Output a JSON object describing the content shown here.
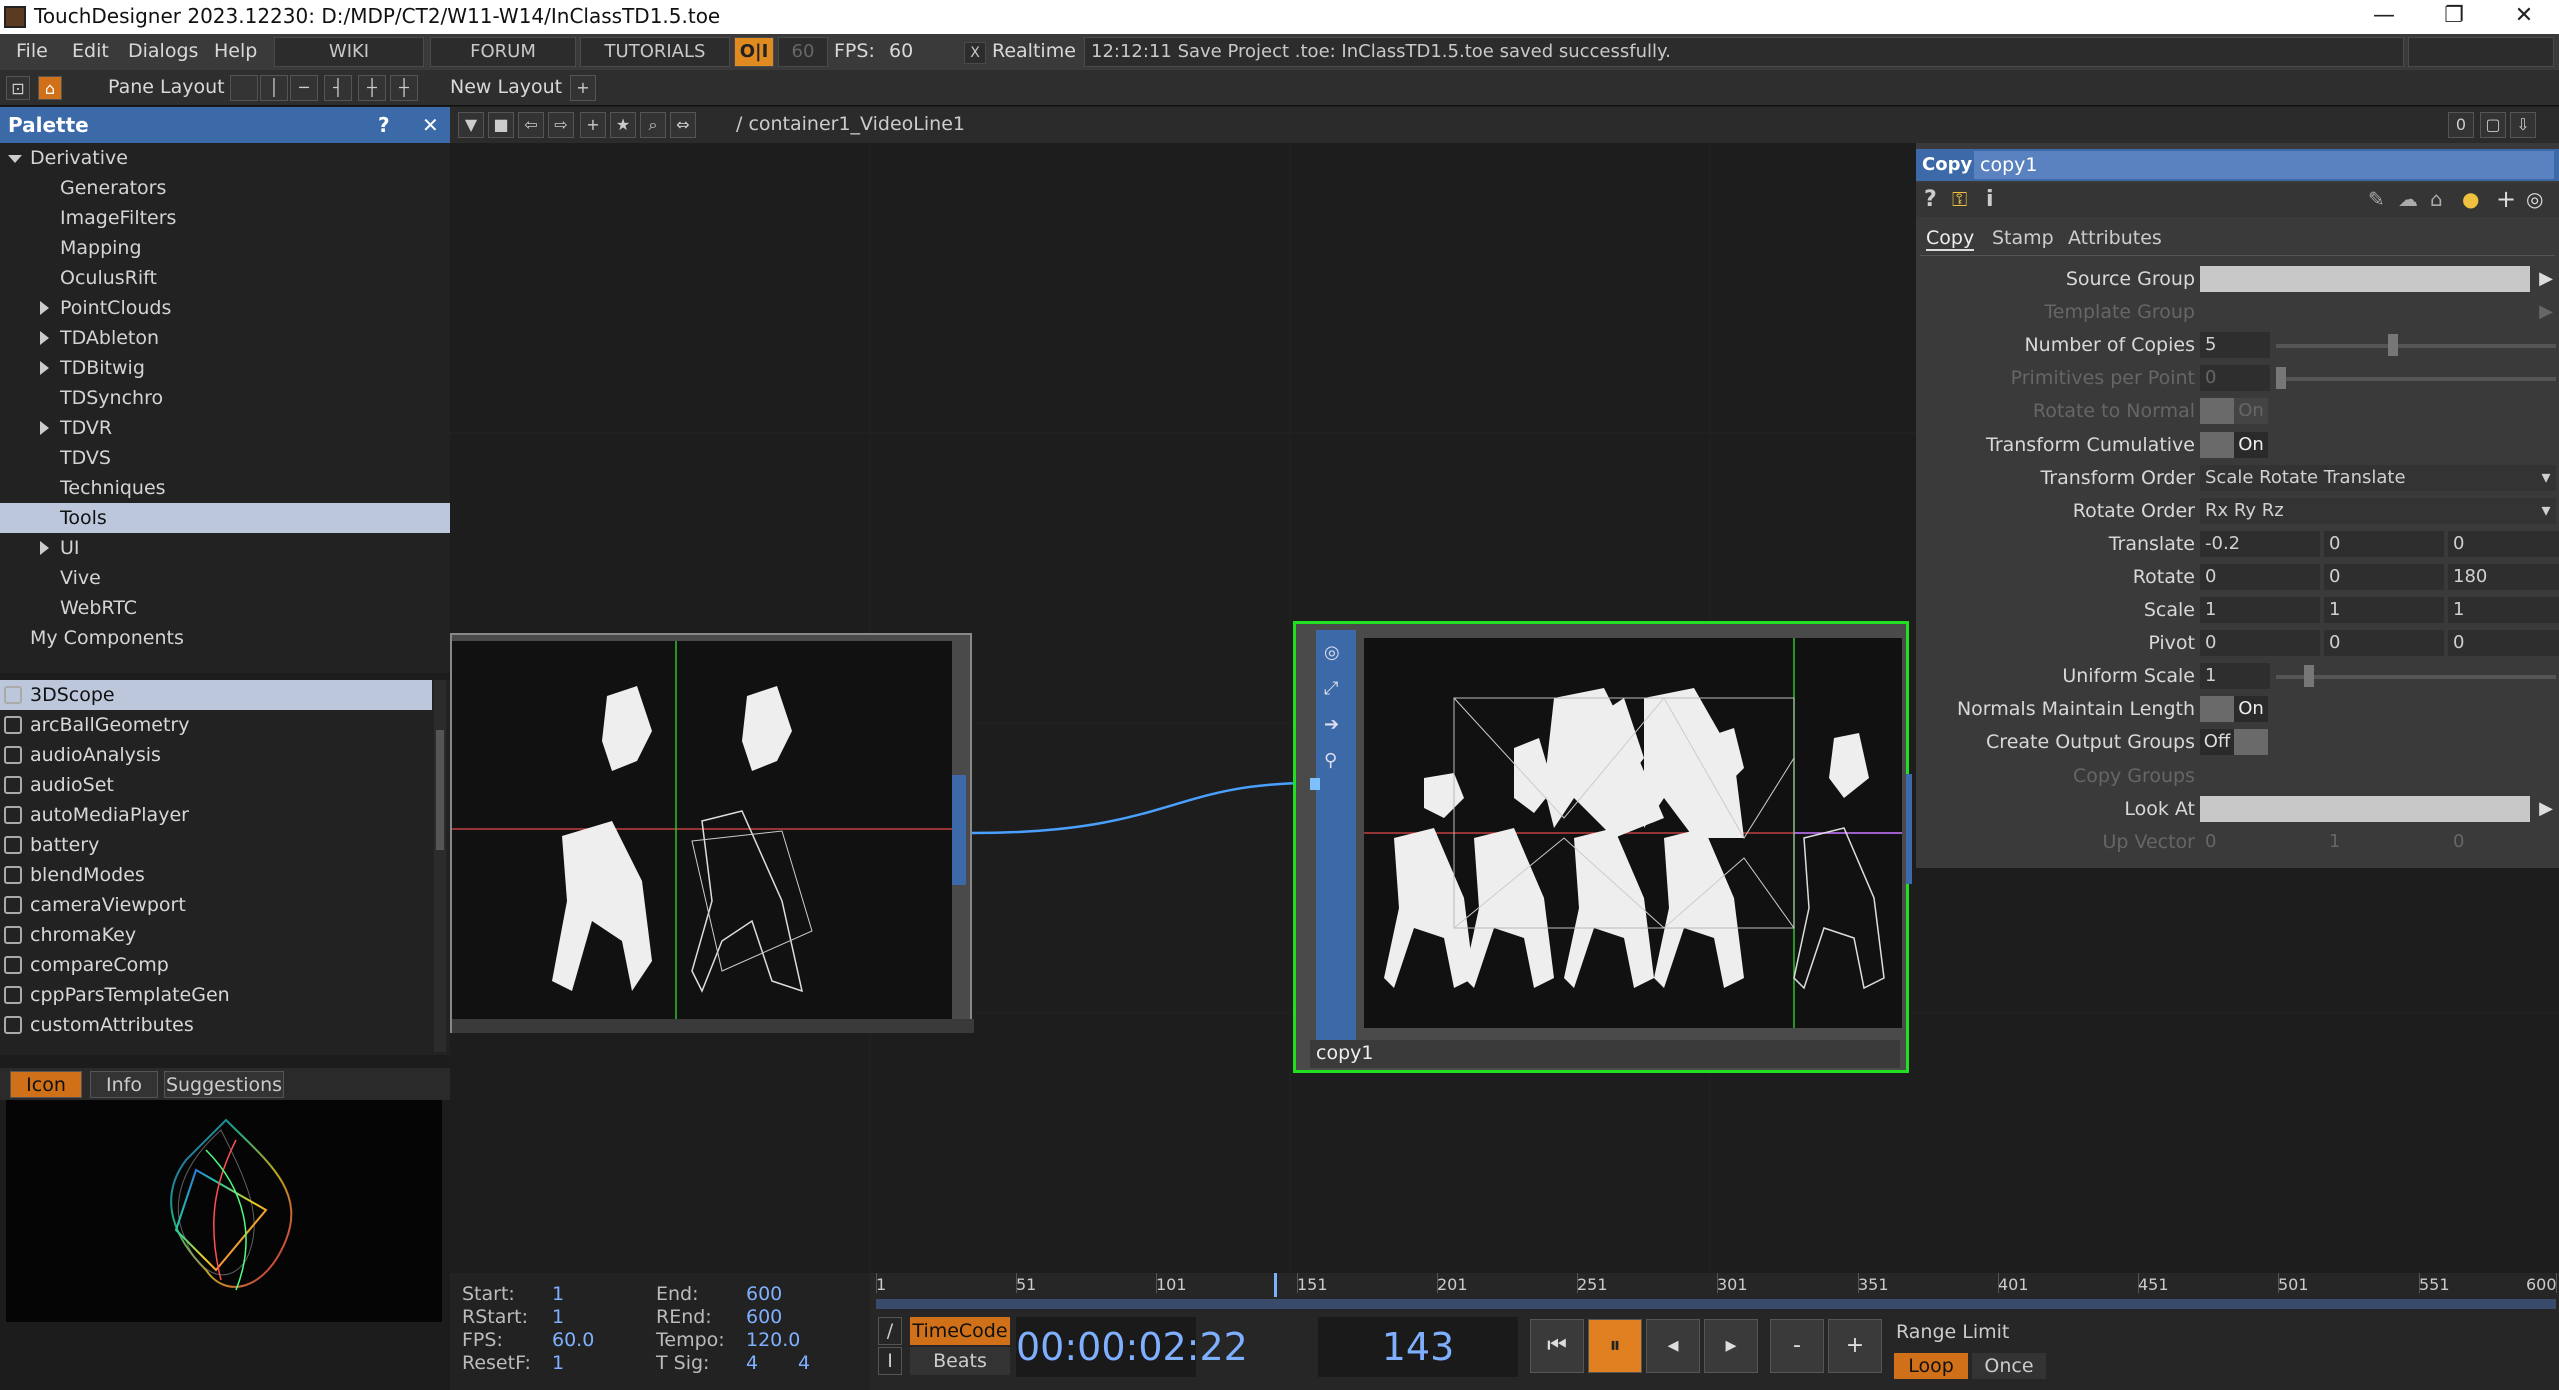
{
  "window": {
    "title": "TouchDesigner 2023.12230: D:/MDP/CT2/W11-W14/InClassTD1.5.toe",
    "minimize": "—",
    "restore": "❐",
    "close": "✕"
  },
  "menu": {
    "items": [
      "File",
      "Edit",
      "Dialogs",
      "Help"
    ],
    "wiki": "WIKI",
    "forum": "FORUM",
    "tutorials": "TUTORIALS",
    "oi": "O|I",
    "fps_target": "60",
    "fps_label": "FPS:",
    "fps_value": "60",
    "realtime_check": "X",
    "realtime_label": "Realtime",
    "status": "12:12:11 Save Project .toe: InClassTD1.5.toe saved successfully."
  },
  "pane_bar": {
    "pane_layout": "Pane Layout",
    "new_layout": "New Layout",
    "add": "+"
  },
  "palette": {
    "title": "Palette",
    "help": "?",
    "close": "✕",
    "tree": [
      {
        "label": "Derivative",
        "indent": 0,
        "arrow": "down"
      },
      {
        "label": "Generators",
        "indent": 2,
        "arrow": ""
      },
      {
        "label": "ImageFilters",
        "indent": 2,
        "arrow": ""
      },
      {
        "label": "Mapping",
        "indent": 2,
        "arrow": ""
      },
      {
        "label": "OculusRift",
        "indent": 2,
        "arrow": ""
      },
      {
        "label": "PointClouds",
        "indent": 2,
        "arrow": "right"
      },
      {
        "label": "TDAbleton",
        "indent": 2,
        "arrow": "right"
      },
      {
        "label": "TDBitwig",
        "indent": 2,
        "arrow": "right"
      },
      {
        "label": "TDSynchro",
        "indent": 2,
        "arrow": ""
      },
      {
        "label": "TDVR",
        "indent": 2,
        "arrow": "right"
      },
      {
        "label": "TDVS",
        "indent": 2,
        "arrow": ""
      },
      {
        "label": "Techniques",
        "indent": 2,
        "arrow": ""
      },
      {
        "label": "Tools",
        "indent": 2,
        "arrow": "",
        "selected": true
      },
      {
        "label": "UI",
        "indent": 2,
        "arrow": "right"
      },
      {
        "label": "Vive",
        "indent": 2,
        "arrow": ""
      },
      {
        "label": "WebRTC",
        "indent": 2,
        "arrow": ""
      },
      {
        "label": "My Components",
        "indent": 1,
        "arrow": ""
      }
    ],
    "components": [
      "3DScope",
      "arcBallGeometry",
      "audioAnalysis",
      "audioSet",
      "autoMediaPlayer",
      "battery",
      "blendModes",
      "cameraViewport",
      "chromaKey",
      "compareComp",
      "cppParsTemplateGen",
      "customAttributes"
    ],
    "selected_component": "3DScope",
    "preview_tabs": [
      "Icon",
      "Info",
      "Suggestions"
    ],
    "active_preview_tab": "Icon"
  },
  "network": {
    "path": "/ container1_VideoLine1",
    "right_counter": "0",
    "node_left_name": "",
    "node_right_name": "copy1"
  },
  "params": {
    "op_type": "Copy",
    "op_name": "copy1",
    "toolbar_icons": [
      "help-icon",
      "python-help-icon",
      "info-icon"
    ],
    "tabs": [
      "Copy",
      "Stamp",
      "Attributes"
    ],
    "active_tab": "Copy",
    "rows": [
      {
        "label": "Source Group",
        "kind": "field",
        "values": [
          ""
        ],
        "dim": false
      },
      {
        "label": "Template Group",
        "kind": "field",
        "values": [
          ""
        ],
        "dim": true
      },
      {
        "label": "Number of Copies",
        "kind": "slider",
        "values": [
          "5"
        ],
        "slider": 0.4,
        "dim": false
      },
      {
        "label": "Primitives per Point",
        "kind": "slider",
        "values": [
          "0"
        ],
        "slider": 0.0,
        "dim": true
      },
      {
        "label": "Rotate to Normal",
        "kind": "toggle",
        "values": [
          "On"
        ],
        "dim": true
      },
      {
        "label": "Transform Cumulative",
        "kind": "toggle",
        "values": [
          "On"
        ],
        "dim": false
      },
      {
        "label": "Transform Order",
        "kind": "menu",
        "values": [
          "Scale Rotate Translate"
        ],
        "dim": false
      },
      {
        "label": "Rotate Order",
        "kind": "menu",
        "values": [
          "Rx Ry Rz"
        ],
        "dim": false
      },
      {
        "label": "Translate",
        "kind": "xyz",
        "values": [
          "-0.2",
          "0",
          "0"
        ],
        "dim": false
      },
      {
        "label": "Rotate",
        "kind": "xyz",
        "values": [
          "0",
          "0",
          "180"
        ],
        "dim": false
      },
      {
        "label": "Scale",
        "kind": "xyz",
        "values": [
          "1",
          "1",
          "1"
        ],
        "dim": false
      },
      {
        "label": "Pivot",
        "kind": "xyz",
        "values": [
          "0",
          "0",
          "0"
        ],
        "dim": false
      },
      {
        "label": "Uniform Scale",
        "kind": "slider",
        "values": [
          "1"
        ],
        "slider": 0.1,
        "dim": false
      },
      {
        "label": "Normals Maintain Length",
        "kind": "toggle",
        "values": [
          "On"
        ],
        "dim": false
      },
      {
        "label": "Create Output Groups",
        "kind": "toggle-off",
        "values": [
          "Off"
        ],
        "dim": false
      },
      {
        "label": "Copy Groups",
        "kind": "none",
        "values": [],
        "dim": true
      },
      {
        "label": "Look At",
        "kind": "field",
        "values": [
          ""
        ],
        "dim": false
      },
      {
        "label": "Up Vector",
        "kind": "xyz",
        "values": [
          "0",
          "1",
          "0"
        ],
        "dim": true
      }
    ]
  },
  "timeline": {
    "start_k": "Start:",
    "start_v": "1",
    "rstart_k": "RStart:",
    "rstart_v": "1",
    "fps_k": "FPS:",
    "fps_v": "60.0",
    "resetf_k": "ResetF:",
    "resetf_v": "1",
    "end_k": "End:",
    "end_v": "600",
    "rend_k": "REnd:",
    "rend_v": "600",
    "tempo_k": "Tempo:",
    "tempo_v": "120.0",
    "tsig_k": "T Sig:",
    "tsig_v1": "4",
    "tsig_v2": "4",
    "ticks": [
      "1",
      "51",
      "101",
      "151",
      "201",
      "251",
      "301",
      "351",
      "401",
      "451",
      "501",
      "551",
      "600"
    ],
    "timecode_btn": "TimeCode",
    "beats_btn": "Beats",
    "timecode": "00:00:02:22",
    "frame": "143",
    "playhead_frame": 143,
    "range_limit": "Range Limit",
    "loop": "Loop",
    "once": "Once",
    "minus": "-",
    "plus": "+"
  }
}
